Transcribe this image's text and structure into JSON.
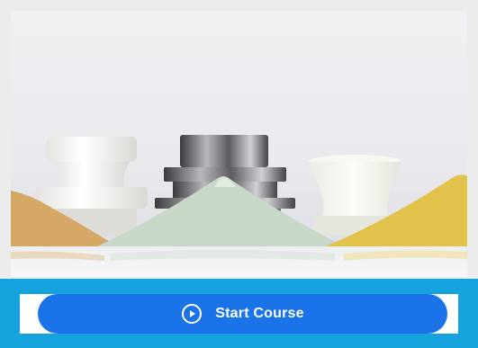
{
  "course": {
    "image_icon": "course-hero-image",
    "start_button": {
      "label": "Start Course",
      "icon": "play-circle-icon"
    }
  },
  "colors": {
    "action_bar": "#16a2dd",
    "button": "#1a73e8",
    "button_text": "#ffffff"
  }
}
